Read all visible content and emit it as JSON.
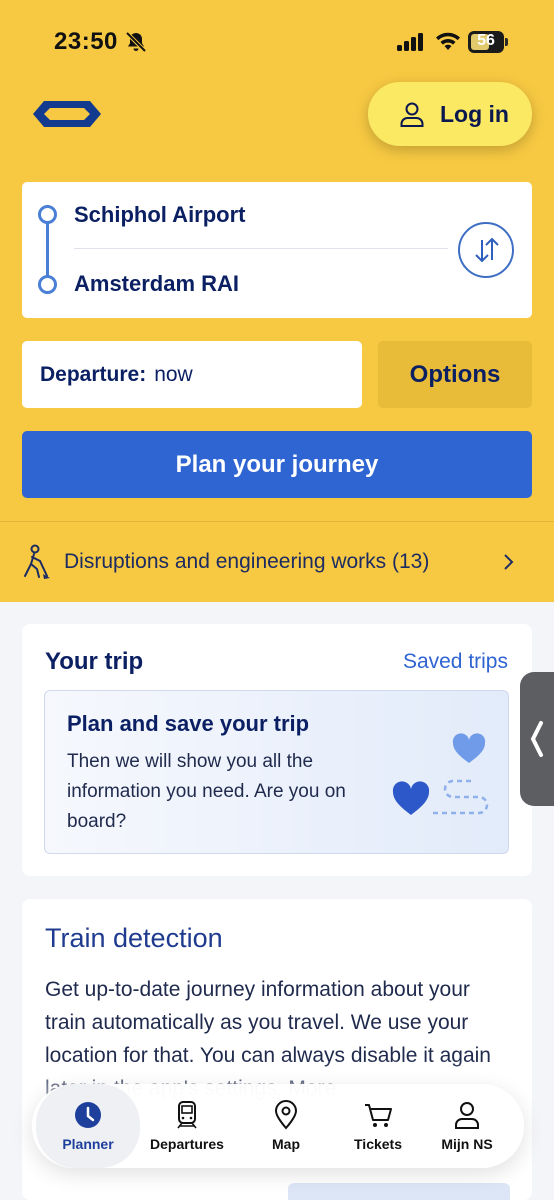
{
  "status_bar": {
    "time": "23:50",
    "battery": "56"
  },
  "header": {
    "login_label": "Log in"
  },
  "route": {
    "from": "Schiphol Airport",
    "to": "Amsterdam RAI"
  },
  "departure": {
    "label": "Departure:",
    "value": "now"
  },
  "options_label": "Options",
  "plan_label": "Plan your journey",
  "disruptions": {
    "label": "Disruptions and engineering works (13)"
  },
  "trip_card": {
    "title": "Your trip",
    "saved_link": "Saved trips",
    "promo_title": "Plan and save your trip",
    "promo_text": "Then we will show you all the information you need. Are you on board?"
  },
  "detection_card": {
    "title": "Train detection",
    "text": "Get up-to-date journey information about your train automatically as you travel. We use your location for that. You can always disable it again later in the app's settings. More"
  },
  "tabs": [
    {
      "label": "Planner",
      "icon": "clock-icon"
    },
    {
      "label": "Departures",
      "icon": "train-icon"
    },
    {
      "label": "Map",
      "icon": "map-pin-icon"
    },
    {
      "label": "Tickets",
      "icon": "cart-icon"
    },
    {
      "label": "Mijn NS",
      "icon": "person-icon"
    }
  ],
  "colors": {
    "brand_yellow": "#f7c942",
    "brand_blue": "#2f64d3",
    "navy": "#0b1f63"
  }
}
